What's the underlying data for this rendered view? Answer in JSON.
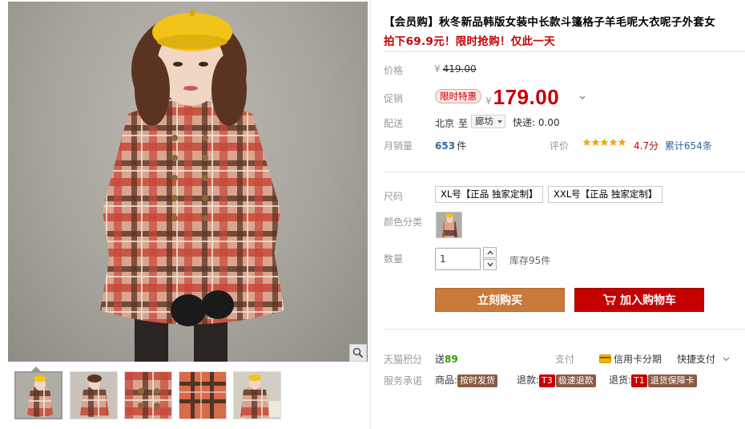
{
  "product": {
    "title": "【会员购】秋冬新品韩版女装中长款斗篷格子羊毛呢大衣呢子外套女",
    "promo": "拍下69.9元！限时抢购！仅此一天"
  },
  "price": {
    "label": "价格",
    "currency": "¥",
    "original": "419.00"
  },
  "promotion": {
    "label": "促销",
    "tag": "限时特惠",
    "currency": "¥",
    "price": "179.00"
  },
  "delivery": {
    "label": "配送",
    "from": "北京",
    "to_word": "至",
    "city": "廊坊",
    "express": "快递: 0.00"
  },
  "sales": {
    "label": "月销量",
    "count": "653",
    "unit": "件"
  },
  "rating": {
    "label": "评价",
    "stars": 5,
    "score": "4.7分",
    "total": "累计654条"
  },
  "size": {
    "label": "尺码",
    "options": [
      "XL号【正品 独家定制】",
      "XXL号【正品 独家定制】"
    ]
  },
  "color": {
    "label": "颜色分类"
  },
  "quantity": {
    "label": "数量",
    "value": "1",
    "stock": "库存95件"
  },
  "actions": {
    "buy": "立刻购买",
    "cart": "加入购物车"
  },
  "bonus": {
    "label": "天猫积分",
    "text": "送",
    "points": "89"
  },
  "payment": {
    "label": "支付",
    "credit": "信用卡分期",
    "quick": "快捷支付"
  },
  "service": {
    "label": "服务承诺",
    "goods_label": "商品:",
    "goods_tag": "按时发货",
    "refund_label": "退款:",
    "refund_badge": "T3",
    "refund_tag": "极速退款",
    "return_label": "退货:",
    "return_badge": "T1",
    "return_tag": "退货保障卡"
  },
  "colors": {
    "accent_red": "#c40000",
    "buy_orange": "#c97a3a",
    "link_blue": "#336699",
    "points_green": "#339900"
  },
  "icons": [
    "zoom-icon",
    "caret-down-icon",
    "star-icon",
    "cart-icon",
    "credit-card-icon",
    "chevron-down-icon"
  ]
}
